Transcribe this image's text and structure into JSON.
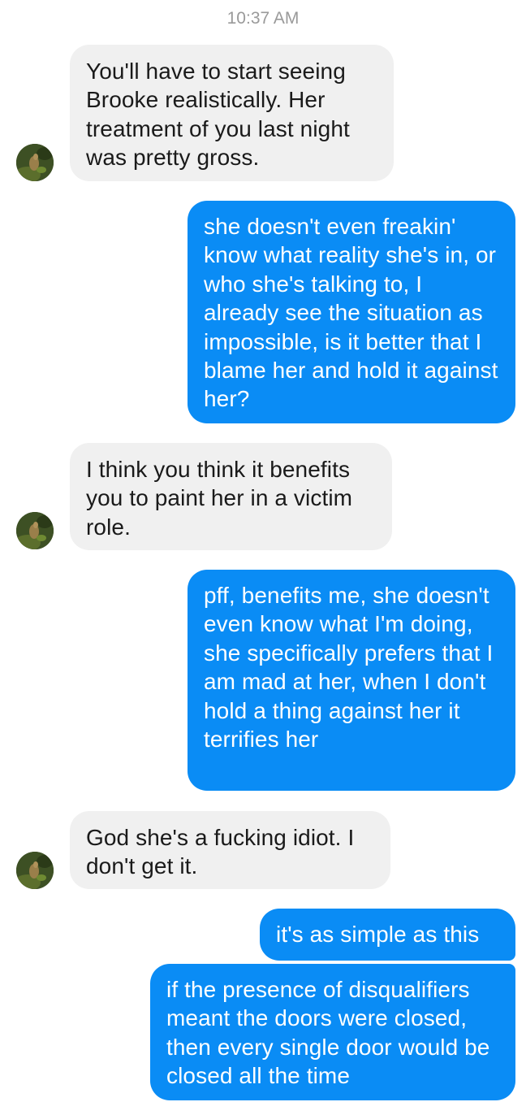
{
  "conversation": {
    "timestamp": "10:37 AM",
    "messages": [
      {
        "direction": "incoming",
        "text": "You'll have to start seeing Brooke realistically. Her treatment of you last night was pretty gross."
      },
      {
        "direction": "outgoing",
        "text": "she doesn't even freakin' know what reality she's in, or who she's talking to, I already see the situation as impossible, is it better that I blame her and hold it against her?"
      },
      {
        "direction": "incoming",
        "text": "I think you think it benefits you to paint her in a victim role."
      },
      {
        "direction": "outgoing",
        "text": "pff, benefits me, she doesn't even know what I'm doing, she specifically prefers that I am mad at her, when I don't hold a thing against her it terrifies her"
      },
      {
        "direction": "incoming",
        "text": "God she's a fucking idiot. I don't get it."
      },
      {
        "direction": "outgoing",
        "text": "it's as simple as this"
      },
      {
        "direction": "outgoing",
        "text": "if the presence of disqualifiers meant the doors were closed, then every single door would be closed all the time"
      }
    ]
  },
  "avatar": {
    "icon": "contact-avatar-photo-icon"
  },
  "colors": {
    "incoming_bubble": "#f0f0f0",
    "outgoing_bubble": "#0a8cf5",
    "timestamp": "#9a9a9a"
  }
}
